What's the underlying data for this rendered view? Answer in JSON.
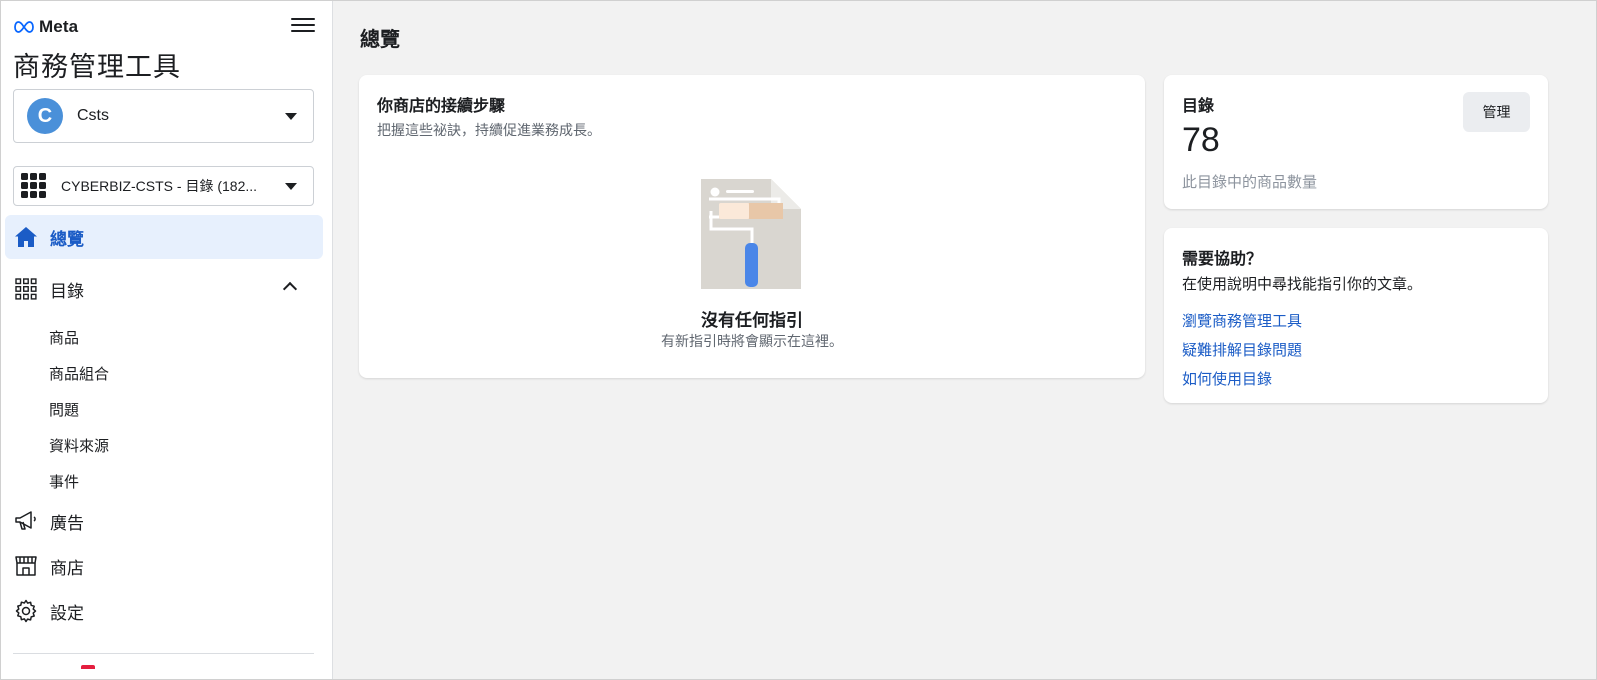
{
  "brand": {
    "name": "Meta",
    "accent": "#1b5cc6"
  },
  "sidebar": {
    "app_title": "商務管理工具",
    "business": {
      "avatar_letter": "C",
      "name": "Csts",
      "avatar_color": "#4a90d9"
    },
    "catalog_selector": {
      "label": "CYBERBIZ-CSTS - 目錄 (182..."
    },
    "nav": {
      "overview": "總覽",
      "catalog": "目錄",
      "catalog_sub": [
        "商品",
        "商品組合",
        "問題",
        "資料來源",
        "事件"
      ],
      "ads": "廣告",
      "shop": "商店",
      "settings": "設定"
    }
  },
  "main": {
    "page_title": "總覽",
    "steps_card": {
      "title": "你商店的接續步驟",
      "subtitle": "把握這些祕訣，持續促進業務成長。",
      "empty_title": "沒有任何指引",
      "empty_subtitle": "有新指引時將會顯示在這裡。"
    },
    "catalog_card": {
      "title": "目錄",
      "manage_label": "管理",
      "count": "78",
      "count_label": "此目錄中的商品數量"
    },
    "help_card": {
      "title": "需要協助？",
      "subtitle": "在使用說明中尋找能指引你的文章。",
      "links": [
        "瀏覽商務管理工具",
        "疑難排解目錄問題",
        "如何使用目錄"
      ]
    }
  }
}
